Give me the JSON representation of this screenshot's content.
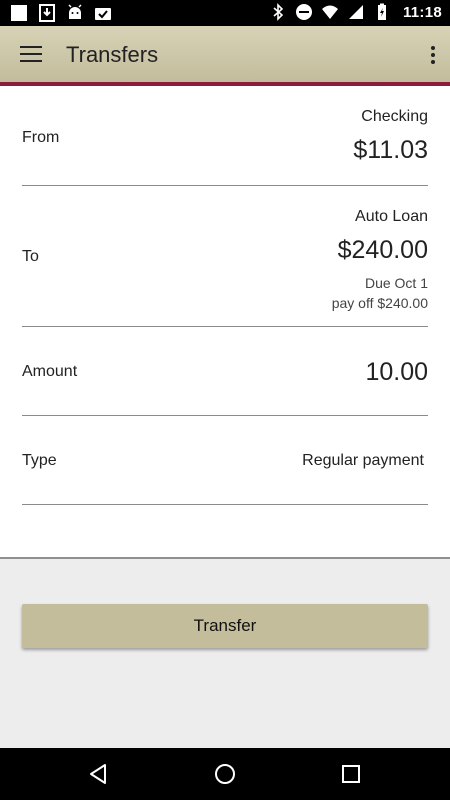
{
  "app": {
    "title": "Transfers",
    "accent_color": "#8a1c3c",
    "bar_color": "#c9c3a5"
  },
  "status_bar": {
    "time": "11:18",
    "left_icons": [
      "notification-square-icon",
      "download-icon",
      "android-icon",
      "clipboard-check-icon"
    ],
    "right_icons": [
      "bluetooth-icon",
      "do-not-disturb-icon",
      "wifi-icon",
      "signal-icon",
      "battery-charging-icon"
    ]
  },
  "form": {
    "from": {
      "label": "From",
      "account": "Checking",
      "balance": "$11.03"
    },
    "to": {
      "label": "To",
      "account": "Auto Loan",
      "balance": "$240.00",
      "due": "Due Oct 1",
      "payoff": "pay off $240.00"
    },
    "amount": {
      "label": "Amount",
      "value": "10.00"
    },
    "type": {
      "label": "Type",
      "value": "Regular payment"
    }
  },
  "actions": {
    "transfer_label": "Transfer"
  },
  "nav_bar": {
    "icons": [
      "back-icon",
      "home-icon",
      "recents-icon"
    ]
  }
}
